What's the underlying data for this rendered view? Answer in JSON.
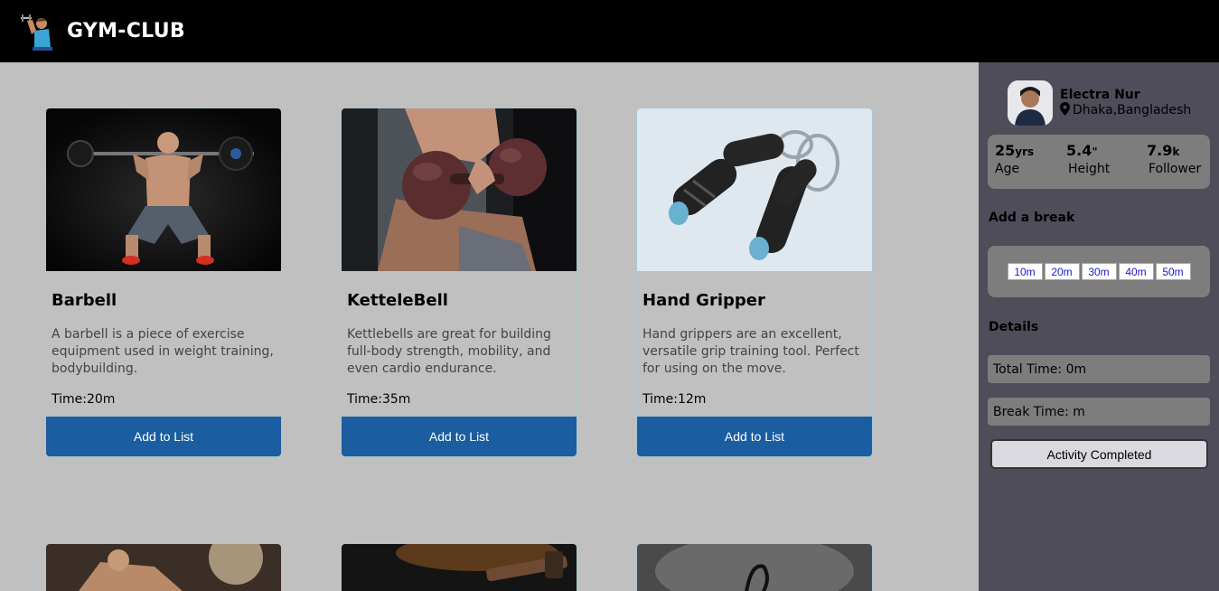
{
  "header": {
    "brand": "GYM-CLUB",
    "logo_icon": "weightlifter-icon"
  },
  "cards": [
    {
      "title": "Barbell",
      "desc": "A barbell is a piece of exercise equipment used in weight training, bodybuilding.",
      "time": "Time:20m",
      "button": "Add to List"
    },
    {
      "title": "KetteleBell",
      "desc": "Kettlebells are great for building full-body strength, mobility, and even cardio endurance.",
      "time": "Time:35m",
      "button": "Add to List"
    },
    {
      "title": "Hand Gripper",
      "desc": "Hand grippers are an excellent, versatile grip training tool. Perfect for using on the move.",
      "time": "Time:12m",
      "button": "Add to List"
    }
  ],
  "profile": {
    "name": "Electra Nur",
    "location": "Dhaka,Bangladesh"
  },
  "stats": [
    {
      "value": "25",
      "unit": "yrs",
      "label": "Age"
    },
    {
      "value": "5.4",
      "unit": "\"",
      "label": "Height"
    },
    {
      "value": "7.9",
      "unit": "k",
      "label": "Follower"
    }
  ],
  "break_section": {
    "title": "Add a break",
    "options": [
      "10m",
      "20m",
      "30m",
      "40m",
      "50m"
    ]
  },
  "details": {
    "title": "Details",
    "total": "Total Time: 0m",
    "break": "Break Time: m",
    "button": "Activity Completed"
  },
  "colors": {
    "accent": "#1a5da0",
    "sidebar": "#4e4d59",
    "topbar": "#000000"
  }
}
